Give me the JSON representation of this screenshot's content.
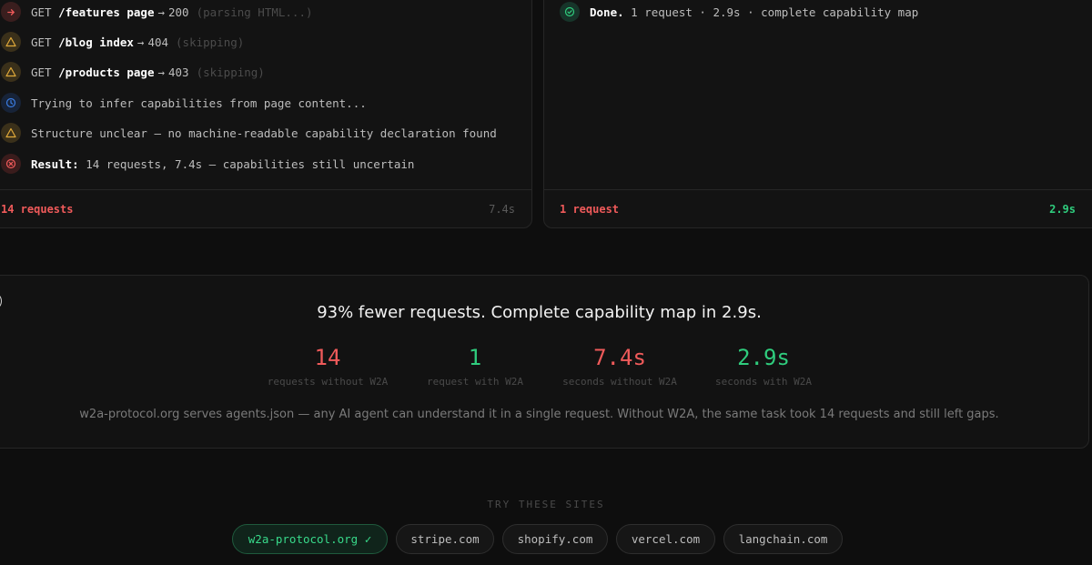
{
  "left_panel": {
    "log": [
      {
        "icon": "arrow-right-icon",
        "method": "GET",
        "path": "/features page",
        "arrow": "→",
        "status": "200",
        "note": "(parsing HTML...)"
      },
      {
        "icon": "warning-icon",
        "method": "GET",
        "path": "/blog index",
        "arrow": "→",
        "status": "404",
        "note": "(skipping)"
      },
      {
        "icon": "warning-icon",
        "method": "GET",
        "path": "/products page",
        "arrow": "→",
        "status": "403",
        "note": "(skipping)"
      },
      {
        "icon": "clock-icon",
        "text": "Trying to infer capabilities from page content..."
      },
      {
        "icon": "warning-icon",
        "text": "Structure unclear — no machine-readable capability declaration found"
      },
      {
        "icon": "error-circle-icon",
        "label": "Result:",
        "text": "14 requests, 7.4s — capabilities still uncertain"
      }
    ],
    "footer": {
      "requests": "14 requests",
      "time": "7.4s"
    }
  },
  "right_panel": {
    "log": [
      {
        "icon": "check-circle-icon",
        "label": "Done.",
        "text": "1 request · 2.9s · complete capability map"
      }
    ],
    "footer": {
      "requests": "1 request",
      "time": "2.9s"
    }
  },
  "summary": {
    "toggle": "–",
    "headline": "93% fewer requests. Complete capability map in 2.9s.",
    "stats": [
      {
        "value": "14",
        "label": "requests without W2A"
      },
      {
        "value": "1",
        "label": "request with W2A"
      },
      {
        "value": "7.4s",
        "label": "seconds without W2A"
      },
      {
        "value": "2.9s",
        "label": "seconds with W2A"
      }
    ],
    "note": "w2a-protocol.org serves agents.json — any AI agent can understand it in a single request. Without W2A, the same task took 14 requests and still left gaps."
  },
  "try_sites": {
    "heading": "TRY THESE SITES",
    "sites": [
      "w2a-protocol.org ✓",
      "stripe.com",
      "shopify.com",
      "vercel.com",
      "langchain.com"
    ],
    "active_index": 0
  },
  "colors": {
    "bad": "#ef5a5a",
    "good": "#2fcc7d",
    "warning": "#e0a93a",
    "info": "#3a7be0"
  }
}
